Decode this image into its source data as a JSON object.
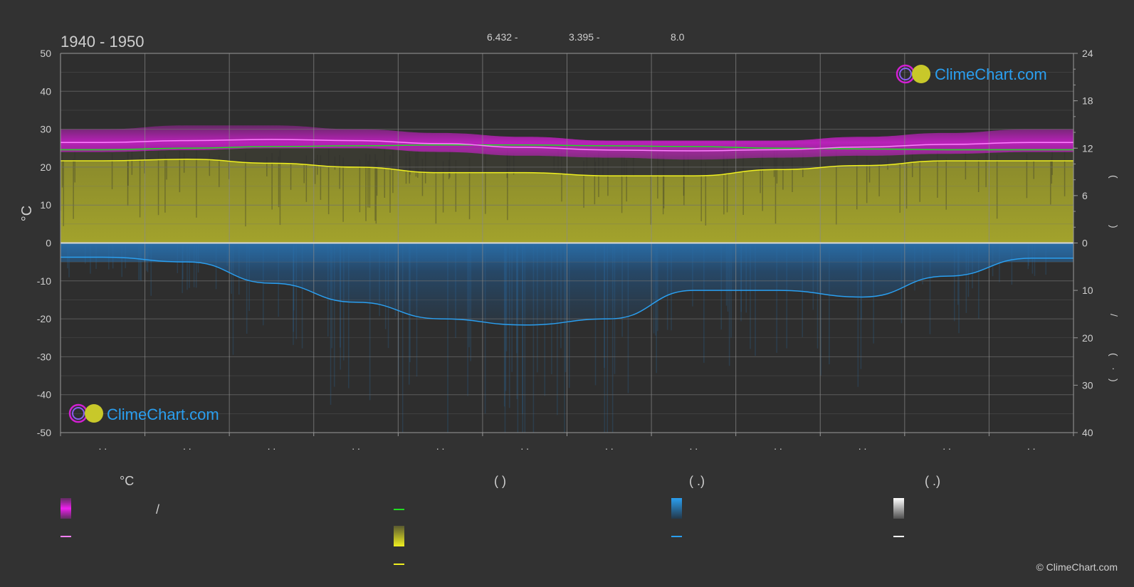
{
  "header": {
    "period": "1940 - 1950",
    "stats": [
      "6.432 -",
      "3.395 -",
      "8.0"
    ]
  },
  "branding": {
    "logo_text": "ClimeChart.com",
    "copyright": "© ClimeChart.com"
  },
  "colors": {
    "background": "#323232",
    "temp_band": "#d21fd2",
    "temp_line": "#ff80ff",
    "daylight_line": "#22dd22",
    "sunshine_fill": "#a8a82c",
    "sunshine_line": "#f0f020",
    "rain_fill": "#2a7bc0",
    "rain_line": "#2a9ff0",
    "grid": "#707070"
  },
  "legend": {
    "col1_head": "°C",
    "col1_slash": "/",
    "col2_head": "(          )",
    "col3_head": "(    .)",
    "col4_head": "(    .)"
  },
  "chart_data": {
    "type": "area",
    "title": "1940 - 1950",
    "ylabel": "°C",
    "y2label": "(  )     (  )     /     (  .  )",
    "ylim": [
      -50,
      50
    ],
    "y_ticks": [
      50,
      40,
      30,
      20,
      10,
      0,
      -10,
      -20,
      -30,
      -40,
      -50
    ],
    "y2_ticks_top": [
      24,
      18,
      12,
      6,
      0
    ],
    "y2_ticks_bottom": [
      0,
      10,
      20,
      30,
      40
    ],
    "x_ticks": [
      ". .",
      ". .",
      ". .",
      ". .",
      ". .",
      ". .",
      ". .",
      ". .",
      ". .",
      ". .",
      ". .",
      ". ."
    ],
    "grid": true,
    "series": [
      {
        "key": "temp_mean",
        "values": [
          26.5,
          27.0,
          27.3,
          27.0,
          26.2,
          25.2,
          24.5,
          24.3,
          24.6,
          25.3,
          26.0,
          26.5
        ]
      },
      {
        "key": "temp_band_max",
        "values": [
          30.0,
          31.0,
          31.0,
          30.0,
          29.0,
          28.0,
          27.0,
          27.0,
          27.0,
          28.0,
          29.0,
          30.0
        ]
      },
      {
        "key": "temp_band_min",
        "values": [
          24.0,
          24.5,
          25.0,
          25.0,
          24.0,
          23.0,
          22.5,
          22.0,
          22.5,
          23.0,
          23.5,
          24.0
        ]
      },
      {
        "key": "daylight",
        "values": [
          11.8,
          12.0,
          12.2,
          12.3,
          12.4,
          12.4,
          12.3,
          12.2,
          12.0,
          11.9,
          11.8,
          11.8
        ]
      },
      {
        "key": "sunshine",
        "values": [
          10.4,
          10.6,
          10.1,
          9.6,
          8.9,
          8.9,
          8.5,
          8.5,
          9.3,
          9.8,
          10.4,
          10.4
        ]
      },
      {
        "key": "rain",
        "values": [
          3.0,
          4.0,
          8.5,
          12.5,
          16.0,
          17.3,
          16.0,
          10.0,
          10.0,
          11.4,
          7.0,
          3.2
        ]
      }
    ]
  }
}
